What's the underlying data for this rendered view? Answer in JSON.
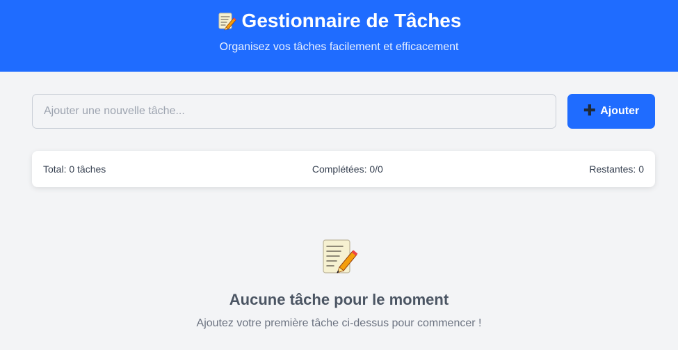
{
  "header": {
    "title": "Gestionnaire de Tâches",
    "subtitle": "Organisez vos tâches facilement et efficacement",
    "title_icon": "memo-icon",
    "background_color": "#1f6cff"
  },
  "task_input": {
    "placeholder": "Ajouter une nouvelle tâche...",
    "value": ""
  },
  "add_button": {
    "label": "Ajouter",
    "icon": "plus-icon"
  },
  "stats": {
    "total": "Total: 0 tâches",
    "completed": "Complétées: 0/0",
    "remaining": "Restantes: 0"
  },
  "empty_state": {
    "icon": "memo-icon",
    "title": "Aucune tâche pour le moment",
    "message": "Ajoutez votre première tâche ci-dessus pour commencer !"
  }
}
